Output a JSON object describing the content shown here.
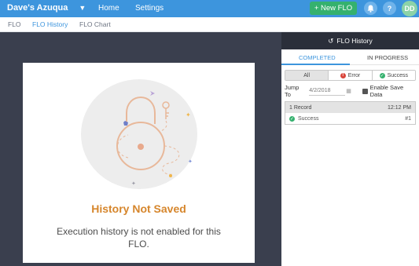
{
  "topbar": {
    "workspace": "Dave's Azuqua",
    "nav": {
      "home": "Home",
      "settings": "Settings"
    },
    "new_flo": "+ New FLO",
    "help": "?",
    "avatar_initials": "DD",
    "accent": "#3d95dd"
  },
  "subnav": {
    "tabs": [
      "FLO",
      "FLO History",
      "FLO Chart"
    ]
  },
  "card": {
    "title": "History Not Saved",
    "message": "Execution history is not enabled for this FLO.",
    "title_color": "#d6862c"
  },
  "panel": {
    "header": "FLO History",
    "tabs": {
      "completed": "COMPLETED",
      "in_progress": "IN PROGRESS"
    },
    "filters": {
      "all": "All",
      "error": "Error",
      "success": "Success"
    },
    "jump": {
      "label": "Jump To",
      "placeholder": "4/2/2018",
      "save_label": "Enable Save Data"
    },
    "record": {
      "count": "1 Record",
      "time": "12:12 PM",
      "status": "Success",
      "id": "#1"
    }
  }
}
